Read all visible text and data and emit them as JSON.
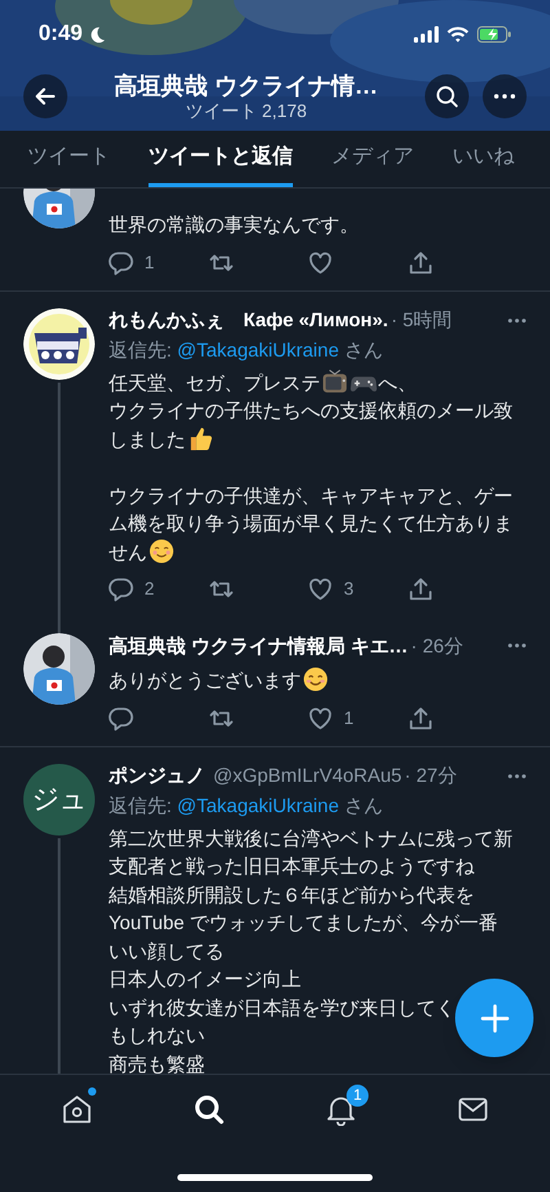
{
  "status_bar": {
    "time": "0:49"
  },
  "header": {
    "title": "高垣典哉 ウクライナ情…",
    "subtitle": "ツイート 2,178"
  },
  "tabs": [
    {
      "label": "ツイート",
      "selected": false
    },
    {
      "label": "ツイートと返信",
      "selected": true
    },
    {
      "label": "メディア",
      "selected": false
    },
    {
      "label": "いいね",
      "selected": false
    }
  ],
  "tweets": [
    {
      "avatar": {
        "kind": "picture"
      },
      "thread_above": false,
      "thread_below": false,
      "body": [
        [
          [
            {
              "kind": "text",
              "text": "世界の常識の事実なんです。"
            }
          ]
        ]
      ],
      "actions": {
        "replies": "1"
      },
      "liked": false
    },
    {
      "avatar": {
        "kind": "picture"
      },
      "name": "れもんかふぇ　Кафе «Лимон».",
      "time": "· 5時間",
      "reply_to": {
        "prefix": "返信先:",
        "handle": "@TakagakiUkraine",
        "suffix": "さん"
      },
      "thread_above": false,
      "thread_below": true,
      "body": [
        [
          [
            {
              "kind": "text",
              "text": "任天堂、セガ、プレステ"
            },
            {
              "kind": "tv"
            },
            {
              "kind": "gamepad"
            },
            {
              "kind": "text",
              "text": "へ、"
            }
          ],
          [
            {
              "kind": "text",
              "text": "ウクライナの子供たちへの支援依頼のメール致"
            }
          ],
          [
            {
              "kind": "text",
              "text": "しました"
            },
            {
              "kind": "thumb"
            }
          ]
        ],
        [
          [
            {
              "kind": "text",
              "text": "ウクライナの子供達が、キャアキャアと、ゲー"
            }
          ],
          [
            {
              "kind": "text",
              "text": "ム機を取り争う場面が早く見たくて仕方ありま"
            }
          ],
          [
            {
              "kind": "text",
              "text": "せん"
            },
            {
              "kind": "smile"
            }
          ]
        ]
      ],
      "actions": {
        "replies": "2",
        "likes": "3"
      },
      "liked": false
    },
    {
      "avatar": {
        "kind": "picture"
      },
      "name": "高垣典哉 ウクライナ情報局 キエ…",
      "time": "· 26分",
      "thread_above": true,
      "thread_below": false,
      "body": [
        [
          [
            {
              "kind": "text",
              "text": "ありがとうございます"
            },
            {
              "kind": "blush"
            }
          ]
        ]
      ],
      "actions": {
        "likes": "1"
      },
      "liked": false
    },
    {
      "avatar": {
        "kind": "initials",
        "text": "ジュ"
      },
      "name": "ポンジュノ",
      "handle": "@xGpBmILrV4oRAu5",
      "time": "· 27分",
      "reply_to": {
        "prefix": "返信先:",
        "handle": "@TakagakiUkraine",
        "suffix": "さん"
      },
      "thread_above": false,
      "thread_below": true,
      "body": [
        [
          [
            {
              "kind": "text",
              "text": "第二次世界大戦後に台湾やベトナムに残って新"
            }
          ],
          [
            {
              "kind": "text",
              "text": "支配者と戦った旧日本軍兵士のようですね"
            }
          ],
          [
            {
              "kind": "text",
              "text": "結婚相談所開設した６年ほど前から代表を"
            }
          ],
          [
            {
              "kind": "text",
              "text": "YouTube でウォッチしてましたが、今が一番"
            }
          ],
          [
            {
              "kind": "text",
              "text": "いい顔してる"
            }
          ],
          [
            {
              "kind": "text",
              "text": "日本人のイメージ向上"
            }
          ],
          [
            {
              "kind": "text",
              "text": "いずれ彼女達が日本語を学び来日してく"
            }
          ],
          [
            {
              "kind": "text",
              "text": "もしれない"
            }
          ],
          [
            {
              "kind": "text",
              "text": "商売も繁盛"
            }
          ]
        ]
      ]
    }
  ],
  "bottom_nav": [
    {
      "kind": "home",
      "selected": false,
      "dot": true
    },
    {
      "kind": "search",
      "selected": true
    },
    {
      "kind": "bell",
      "selected": false,
      "badge": "1"
    },
    {
      "kind": "mail",
      "selected": false
    }
  ]
}
